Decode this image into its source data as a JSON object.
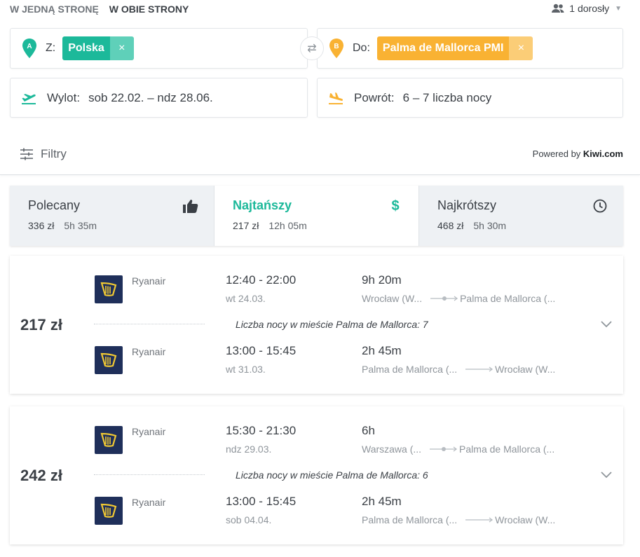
{
  "trip_types": {
    "one_way": "W JEDNĄ STRONĘ",
    "return": "W OBIE STRONY"
  },
  "passengers": {
    "label": "1 dorosły"
  },
  "search": {
    "from_label": "Z:",
    "from_value": "Polska",
    "from_pin": "A",
    "to_label": "Do:",
    "to_value": "Palma de Mallorca PMI",
    "to_pin": "B",
    "remove_symbol": "×",
    "swap_symbol": "⇄",
    "departure_label": "Wylot:",
    "departure_value": "sob 22.02. – ndz 28.06.",
    "return_label": "Powrót:",
    "return_value": "6 – 7 liczba nocy"
  },
  "filters": {
    "label": "Filtry"
  },
  "powered_by": {
    "prefix": "Powered by ",
    "brand": "Kiwi.com"
  },
  "sort_tabs": [
    {
      "title": "Polecany",
      "price": "336 zł",
      "duration": "5h 35m",
      "icon": "thumbs-up-icon"
    },
    {
      "title": "Najtańszy",
      "price": "217 zł",
      "duration": "12h 05m",
      "icon": "dollar-icon",
      "symbol": "$"
    },
    {
      "title": "Najkrótszy",
      "price": "468 zł",
      "duration": "5h 30m",
      "icon": "clock-icon"
    }
  ],
  "results": [
    {
      "price": "217 zł",
      "nights": "Liczba nocy w mieście Palma de Mallorca: 7",
      "outbound": {
        "airline": "Ryanair",
        "times": "12:40 - 22:00",
        "date": "wt 24.03.",
        "duration": "9h 20m",
        "from": "Wrocław (W...",
        "to": "Palma de Mallorca (..."
      },
      "inbound": {
        "airline": "Ryanair",
        "times": "13:00 - 15:45",
        "date": "wt 31.03.",
        "duration": "2h 45m",
        "from": "Palma de Mallorca (...",
        "to": "Wrocław (W..."
      }
    },
    {
      "price": "242 zł",
      "nights": "Liczba nocy w mieście Palma de Mallorca: 6",
      "outbound": {
        "airline": "Ryanair",
        "times": "15:30 - 21:30",
        "date": "ndz 29.03.",
        "duration": "6h",
        "from": "Warszawa (...",
        "to": "Palma de Mallorca (..."
      },
      "inbound": {
        "airline": "Ryanair",
        "times": "13:00 - 15:45",
        "date": "sob 04.04.",
        "duration": "2h 45m",
        "from": "Palma de Mallorca (...",
        "to": "Wrocław (W..."
      }
    }
  ],
  "colors": {
    "accent_green": "#1cb99a",
    "accent_orange": "#f9b233",
    "ryanair_navy": "#1f2f5a"
  }
}
